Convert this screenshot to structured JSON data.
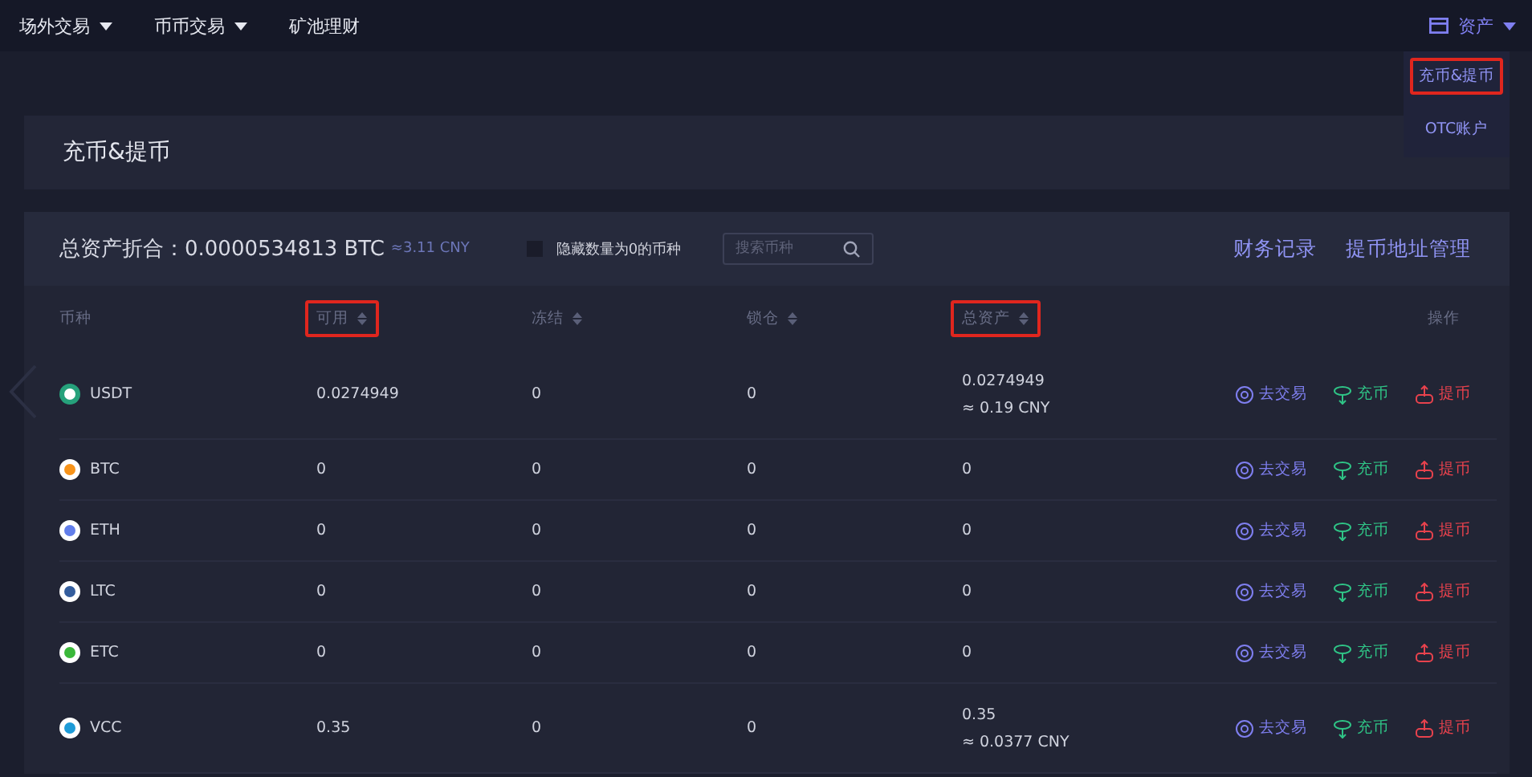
{
  "nav": {
    "items": [
      {
        "label": "场外交易",
        "dropdown": true
      },
      {
        "label": "币币交易",
        "dropdown": true
      },
      {
        "label": "矿池理财",
        "dropdown": false
      }
    ],
    "assets": {
      "label": "资产",
      "menu": [
        {
          "label": "充币&提币",
          "highlighted": true
        },
        {
          "label": "OTC账户",
          "highlighted": false
        }
      ]
    }
  },
  "page_title": "充币&提币",
  "summary": {
    "label": "总资产折合：",
    "btc": "0.0000534813 BTC",
    "cny": "≈3.11 CNY",
    "hide_zero": {
      "label": "隐藏数量为0的币种",
      "checked": false
    },
    "search": {
      "placeholder": "搜索币种"
    },
    "links": [
      "财务记录",
      "提币地址管理"
    ]
  },
  "table": {
    "columns": [
      {
        "label": "币种",
        "sortable": false,
        "highlighted": false
      },
      {
        "label": "可用",
        "sortable": true,
        "highlighted": true
      },
      {
        "label": "冻结",
        "sortable": true,
        "highlighted": false
      },
      {
        "label": "锁仓",
        "sortable": true,
        "highlighted": false
      },
      {
        "label": "总资产",
        "sortable": true,
        "highlighted": true
      },
      {
        "label": "操作",
        "sortable": false,
        "highlighted": false
      }
    ],
    "rows": [
      {
        "coin": "USDT",
        "color": "#26a17b",
        "available": "0.0274949",
        "frozen": "0",
        "locked": "0",
        "total": "0.0274949",
        "total_cny": "≈ 0.19 CNY",
        "actions": [
          {
            "label": "去交易",
            "kind": "trade"
          },
          {
            "label": "充币",
            "kind": "deposit"
          },
          {
            "label": "提币",
            "kind": "withdraw"
          }
        ]
      },
      {
        "coin": "BTC",
        "color": "#f7931a",
        "available": "0",
        "frozen": "0",
        "locked": "0",
        "total": "0",
        "actions": [
          {
            "label": "去交易",
            "kind": "trade"
          },
          {
            "label": "充币",
            "kind": "deposit"
          },
          {
            "label": "提币",
            "kind": "withdraw"
          }
        ]
      },
      {
        "coin": "ETH",
        "color": "#627eea",
        "available": "0",
        "frozen": "0",
        "locked": "0",
        "total": "0",
        "actions": [
          {
            "label": "去交易",
            "kind": "trade"
          },
          {
            "label": "充币",
            "kind": "deposit"
          },
          {
            "label": "提币",
            "kind": "withdraw"
          }
        ]
      },
      {
        "coin": "LTC",
        "color": "#345d9d",
        "available": "0",
        "frozen": "0",
        "locked": "0",
        "total": "0",
        "actions": [
          {
            "label": "去交易",
            "kind": "trade"
          },
          {
            "label": "充币",
            "kind": "deposit"
          },
          {
            "label": "提币",
            "kind": "withdraw"
          }
        ]
      },
      {
        "coin": "ETC",
        "color": "#3ab83a",
        "available": "0",
        "frozen": "0",
        "locked": "0",
        "total": "0",
        "actions": [
          {
            "label": "去交易",
            "kind": "trade"
          },
          {
            "label": "充币",
            "kind": "deposit"
          },
          {
            "label": "提币",
            "kind": "withdraw"
          }
        ]
      },
      {
        "coin": "VCC",
        "color": "#1e9bd7",
        "available": "0.35",
        "frozen": "0",
        "locked": "0",
        "total": "0.35",
        "total_cny": "≈ 0.0377 CNY",
        "actions": [
          {
            "label": "去交易",
            "kind": "trade"
          },
          {
            "label": "充币",
            "kind": "deposit"
          },
          {
            "label": "提币",
            "kind": "withdraw"
          }
        ]
      }
    ]
  }
}
